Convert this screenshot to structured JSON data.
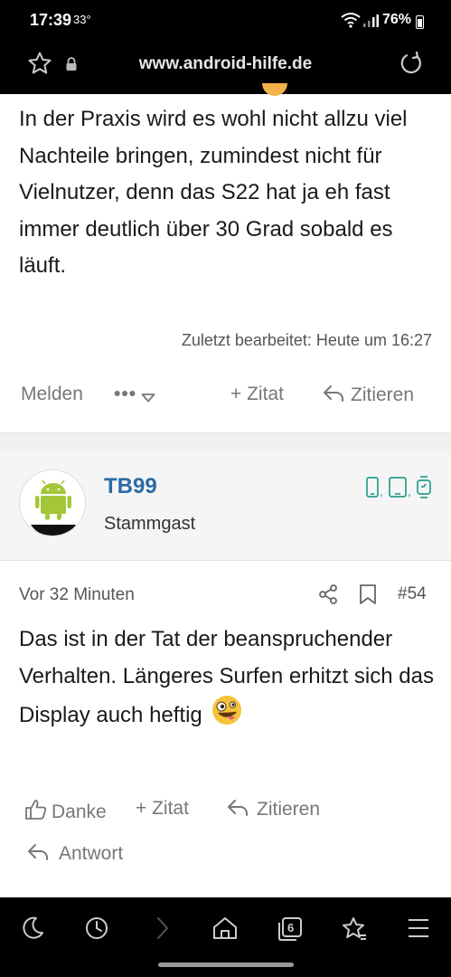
{
  "status_bar": {
    "time": "17:39",
    "temperature": "33°",
    "battery": "76%"
  },
  "browser": {
    "url": "www.android-hilfe.de",
    "tab_count": "6"
  },
  "post1": {
    "text": "In der Praxis wird es wohl nicht allzu viel Nachteile bringen, zumindest nicht für Vielnutzer, denn das S22 hat ja eh fast immer deutlich über 30 Grad sobald es läuft.",
    "edited": "Zuletzt bearbeitet: Heute um 16:27",
    "actions": {
      "report": "Melden",
      "more": "•••",
      "quote": "+ Zitat",
      "cite": "Zitieren"
    }
  },
  "post2": {
    "username": "TB99",
    "user_title": "Stammgast",
    "avatar_label": "Android",
    "time_ago": "Vor 32 Minuten",
    "post_number": "#54",
    "text": "Das ist in der Tat der beanspruchender Verhalten. Längeres Surfen erhitzt sich das Display auch heftig",
    "actions": {
      "like": "Danke",
      "quote": "+ Zitat",
      "cite": "Zitieren",
      "reply": "Antwort"
    }
  },
  "colors": {
    "accent": "#2a6aa8",
    "android_green": "#a4c639",
    "device_teal": "#2a9d8f"
  }
}
